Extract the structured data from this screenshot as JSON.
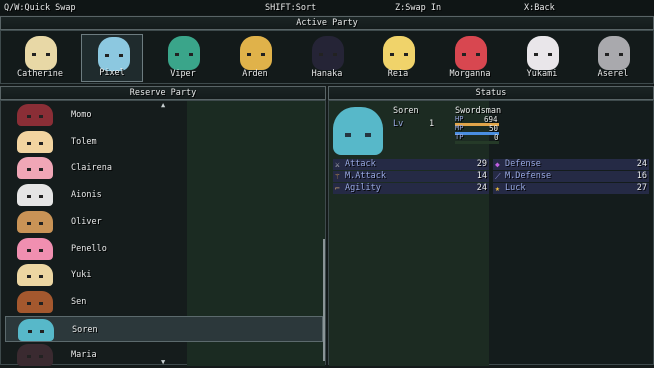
{
  "help": {
    "quick_swap": "Q/W:Quick Swap",
    "sort": "SHIFT:Sort",
    "swap_in": "Z:Swap In",
    "back": "X:Back"
  },
  "active_party": {
    "title": "Active Party",
    "members": [
      {
        "name": "Catherine",
        "hair": "#e8d8a6"
      },
      {
        "name": "Pixel",
        "hair": "#8cc8e0",
        "selected": true
      },
      {
        "name": "Viper",
        "hair": "#3aa58a"
      },
      {
        "name": "Arden",
        "hair": "#e0b24a"
      },
      {
        "name": "Hanaka",
        "hair": "#252436"
      },
      {
        "name": "Reia",
        "hair": "#f0d36a"
      },
      {
        "name": "Morganna",
        "hair": "#d84750"
      },
      {
        "name": "Yukami",
        "hair": "#e9e6ea"
      },
      {
        "name": "Aserel",
        "hair": "#a9a9ad"
      }
    ]
  },
  "reserve_party": {
    "title": "Reserve Party",
    "members": [
      {
        "name": "Momo",
        "hair": "#8a2e36"
      },
      {
        "name": "Tolem",
        "hair": "#f2d4a0"
      },
      {
        "name": "Clairena",
        "hair": "#f0a6b6"
      },
      {
        "name": "Aionis",
        "hair": "#e5e5e5"
      },
      {
        "name": "Oliver",
        "hair": "#c99356"
      },
      {
        "name": "Penello",
        "hair": "#f08fb0"
      },
      {
        "name": "Yuki",
        "hair": "#ecd6a2"
      },
      {
        "name": "Sen",
        "hair": "#a4582e"
      },
      {
        "name": "Soren",
        "hair": "#57b8c9",
        "selected": true
      },
      {
        "name": "Maria",
        "hair": "#3a2a30"
      }
    ]
  },
  "status": {
    "title": "Status",
    "name": "Soren",
    "class": "Swordsman",
    "level_label": "Lv",
    "level": "1",
    "hp_label": "HP",
    "hp": "694",
    "hp_fill": 1.0,
    "mp_label": "MP",
    "mp": "50",
    "mp_fill": 1.0,
    "tp_label": "TP",
    "tp": "0",
    "tp_fill": 0.0,
    "stats": [
      {
        "icon": "sword-icon",
        "glyph": "⚔",
        "color": "#e8e8e8",
        "label": "Attack",
        "value": "29"
      },
      {
        "icon": "shield-gem-icon",
        "glyph": "◆",
        "color": "#c060e0",
        "label": "Defense",
        "value": "24"
      },
      {
        "icon": "magic-staff-icon",
        "glyph": "⚚",
        "color": "#d8a050",
        "label": "M.Attack",
        "value": "14"
      },
      {
        "icon": "wand-icon",
        "glyph": "⟋",
        "color": "#9090e0",
        "label": "M.Defense",
        "value": "16"
      },
      {
        "icon": "boot-icon",
        "glyph": "⌐",
        "color": "#c8a070",
        "label": "Agility",
        "value": "24"
      },
      {
        "icon": "star-icon",
        "glyph": "★",
        "color": "#f0c040",
        "label": "Luck",
        "value": "27"
      }
    ]
  },
  "colors": {
    "hp_gauge": "#e2a54a",
    "mp_gauge": "#4a8ee0",
    "tp_gauge": "#3aa040",
    "stat_label": "#98a8e0"
  }
}
